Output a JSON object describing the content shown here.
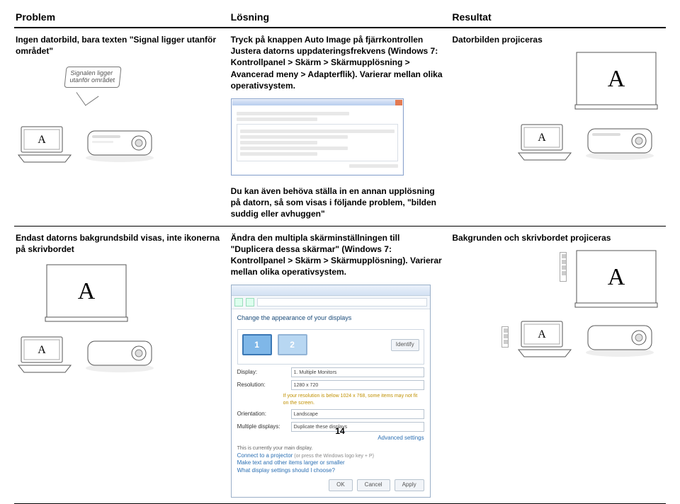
{
  "headers": {
    "problem": "Problem",
    "losning": "Lösning",
    "resultat": "Resultat"
  },
  "row1": {
    "problem_text": "Ingen datorbild, bara texten \"Signal ligger utanför området\"",
    "callout_text": "Signalen ligger\nutanför området",
    "losning_text": "Tryck på knappen Auto Image på fjärrkontrollen Justera datorns uppdateringsfrekvens (Windows 7: Kontrollpanel > Skärm > Skärmupplösning > Avancerad meny > Adapterflik). Varierar mellan olika operativsystem.",
    "resultat_text": "Datorbilden projiceras"
  },
  "mid_note": "Du kan även behöva ställa in en annan upplösning på datorn, så som visas i följande problem, \"bilden suddig eller avhuggen\"",
  "row2": {
    "problem_text": "Endast datorns bakgrundsbild visas, inte ikonerna på skrivbordet",
    "losning_text": "Ändra den multipla skärminställningen till \"Duplicera dessa skärmar\" (Windows 7: Kontrollpanel > Skärm > Skärmupplösning). Varierar mellan olika operativsystem.",
    "resultat_text": "Bakgrunden och skrivbordet projiceras"
  },
  "screenshot2": {
    "title": "Change the appearance of your displays",
    "identify": "Identify",
    "mon1": "1",
    "mon2": "2",
    "labels": {
      "display": "Display:",
      "resolution": "Resolution:",
      "orientation": "Orientation:",
      "multi": "Multiple displays:"
    },
    "values": {
      "display": "1. Multiple Monitors",
      "resolution": "1280 x 720",
      "orientation": "Landscape",
      "multi": "Duplicate these displays"
    },
    "res_hint": "If your resolution is below 1024 x 768, some items may not fit on the screen.",
    "advanced": "Advanced settings",
    "group_hint": "This is currently your main display.",
    "group_link": "Connect to a projector",
    "group_sub": "(or press the Windows logo key + P)",
    "link1": "Make text and other items larger or smaller",
    "link2": "What display settings should I choose?",
    "ok": "OK",
    "cancel": "Cancel",
    "apply": "Apply"
  },
  "icon_mark": "A",
  "page_number": "14"
}
